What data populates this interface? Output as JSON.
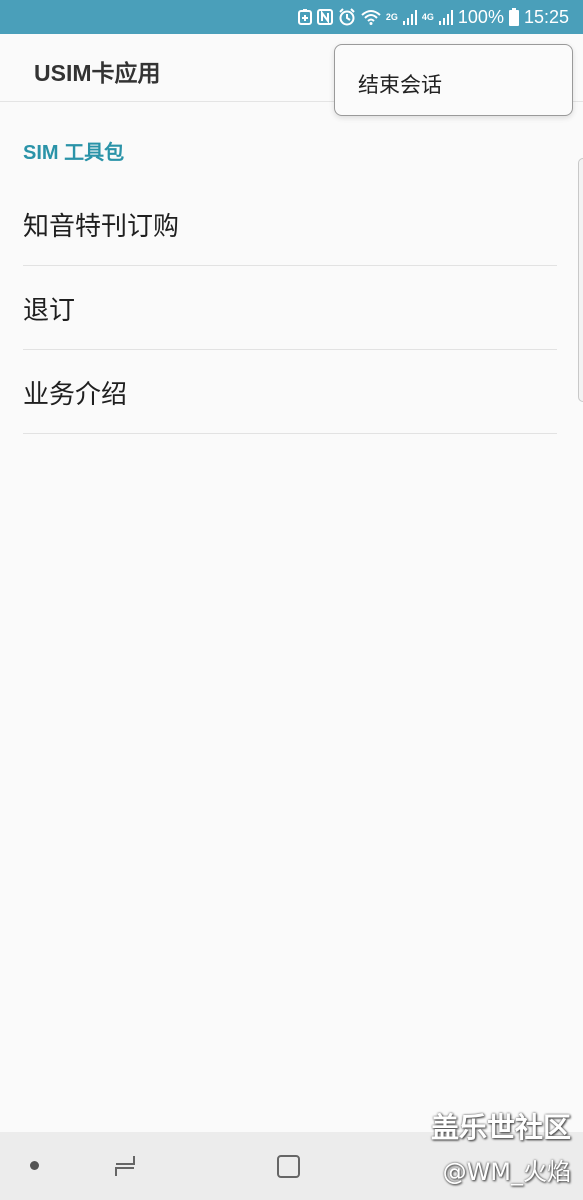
{
  "status_bar": {
    "battery": "100%",
    "time": "15:25",
    "network_2g": "2G",
    "network_4g": "4G",
    "icons": [
      "battery-saver-icon",
      "nfc-icon",
      "alarm-icon",
      "wifi-icon",
      "signal-2g-icon",
      "signal-4g-icon",
      "battery-icon"
    ]
  },
  "app_bar": {
    "title": "USIM卡应用"
  },
  "popup_menu": {
    "items": [
      {
        "label": "结束会话"
      }
    ]
  },
  "section": {
    "header": "SIM 工具包"
  },
  "list": {
    "items": [
      {
        "label": "知音特刊订购"
      },
      {
        "label": "退订"
      },
      {
        "label": "业务介绍"
      }
    ]
  },
  "nav_bar": {
    "icons": [
      "dot-icon",
      "recent-apps-icon",
      "home-icon"
    ]
  },
  "watermark": {
    "line1": "盖乐世社区",
    "line2": "@WM_火焰"
  },
  "colors": {
    "status_bar": "#4a9fba",
    "accent": "#2a93a8",
    "background": "#fafafa"
  }
}
